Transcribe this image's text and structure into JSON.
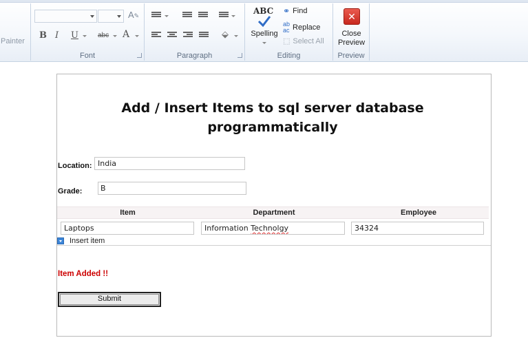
{
  "ribbon": {
    "clipboard": {
      "painter_label": "Painter"
    },
    "font": {
      "group_label": "Font",
      "bold": "B",
      "italic": "I",
      "underline": "U",
      "strike": "abc",
      "color": "A"
    },
    "paragraph": {
      "group_label": "Paragraph"
    },
    "editing": {
      "group_label": "Editing",
      "spelling_label": "Spelling",
      "spelling_glyph": "ABC",
      "find_label": "Find",
      "replace_label": "Replace",
      "select_all_label": "Select All"
    },
    "preview": {
      "group_label": "Preview",
      "close_label_1": "Close",
      "close_label_2": "Preview"
    }
  },
  "form": {
    "title": "Add / Insert Items to sql server database programmatically",
    "location_label": "Location:",
    "location_value": "India",
    "grade_label": "Grade:",
    "grade_value": "B",
    "columns": [
      "Item",
      "Department",
      "Employee"
    ],
    "row": {
      "item": "Laptops",
      "department_prefix": "Information ",
      "department_misspelled": "Technolgy",
      "employee": "34324"
    },
    "insert_label": "Insert item",
    "status_message": "Item Added !!",
    "submit_label": "Submit"
  },
  "colors": {
    "status": "#cc0000",
    "accent": "#3d86d8",
    "close_red": "#d9362b"
  }
}
